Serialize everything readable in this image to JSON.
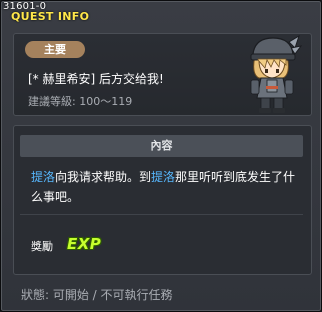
{
  "window": {
    "quest_id": "31601-0",
    "title": "QUEST INFO"
  },
  "summary": {
    "category_badge": "主要",
    "quest_name_bracket": "[* 赫里希安]",
    "quest_name_text": " 后方交给我!",
    "level_label": "建議等級:",
    "level_range": " 100～119"
  },
  "details": {
    "header": "內容",
    "description_parts": {
      "npc1": "提洛",
      "text1": "向我请求帮助。到",
      "npc2": "提洛",
      "text2": "那里听听到底发生了什么事吧。"
    },
    "reward_label": "獎勵",
    "reward_icon_text": "EXP"
  },
  "status": {
    "label": "狀態:",
    "value": " 可開始 / 不可執行任務"
  },
  "colors": {
    "title": "#ffe74a",
    "npc_name": "#57b8ff",
    "badge": "#a5825d",
    "exp": "#c6ff2e"
  },
  "icons": {
    "npc_portrait": "knight-character-icon",
    "reward": "exp-icon"
  }
}
